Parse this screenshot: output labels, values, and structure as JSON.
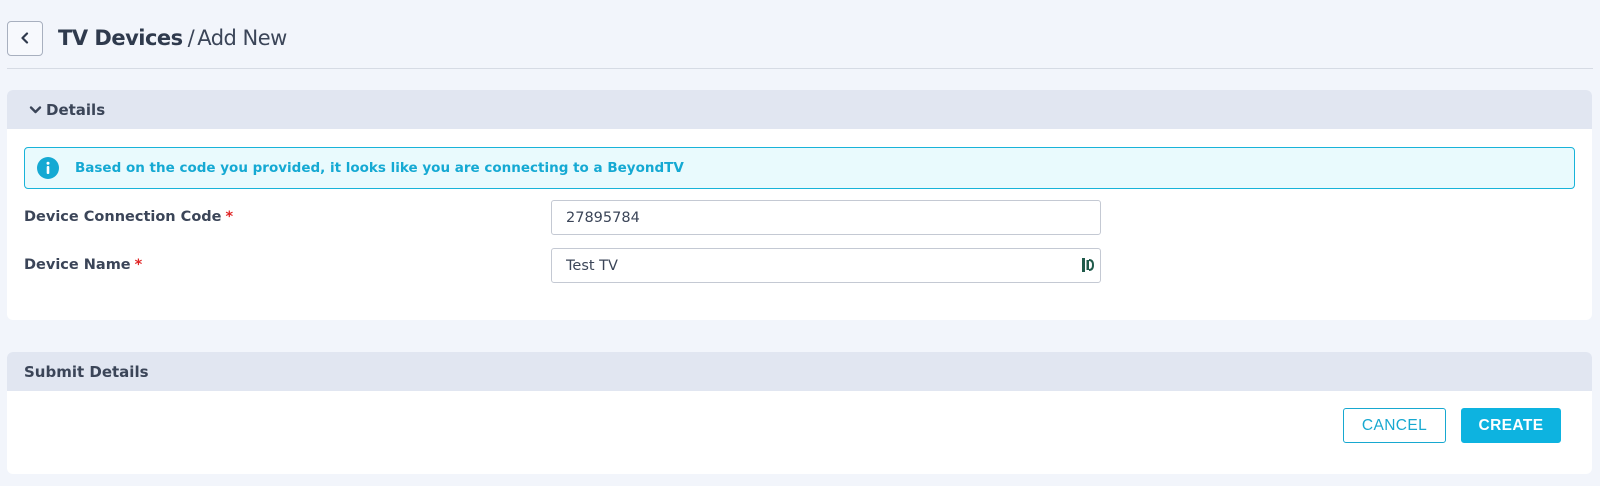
{
  "header": {
    "back_icon": "chevron-left-icon",
    "title_main": "TV Devices",
    "title_separator": "/",
    "title_sub": "Add New"
  },
  "details": {
    "section_title": "Details",
    "collapse_icon": "chevron-down-icon",
    "info_icon": "info-circle-icon",
    "info_message": "Based on the code you provided, it looks like you are connecting to a BeyondTV",
    "fields": [
      {
        "label": "Device Connection Code",
        "required_mark": "*",
        "value": "27895784"
      },
      {
        "label": "Device Name",
        "required_mark": "*",
        "value": "Test TV"
      }
    ]
  },
  "submit": {
    "section_title": "Submit Details",
    "cancel_label": "CANCEL",
    "create_label": "CREATE"
  },
  "colors": {
    "accent": "#0db3e0",
    "info_text": "#15a9d3",
    "required": "#e02424",
    "panel_header": "#e1e6f1",
    "background": "#f2f5fb"
  }
}
